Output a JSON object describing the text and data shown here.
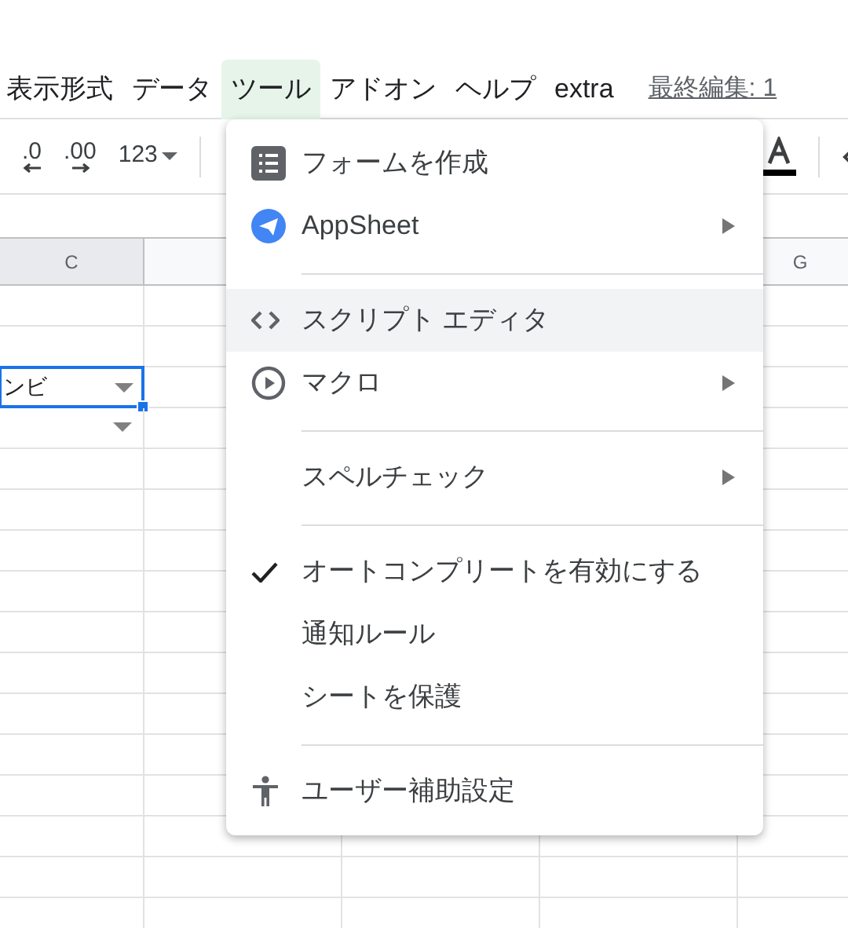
{
  "menu_bar": [
    {
      "label": "表示形式",
      "selected": false
    },
    {
      "label": "データ",
      "selected": false
    },
    {
      "label": "ツール",
      "selected": true
    },
    {
      "label": "アドオン",
      "selected": false
    },
    {
      "label": "ヘルプ",
      "selected": false
    },
    {
      "label": "extra",
      "selected": false
    }
  ],
  "last_edit": "最終編集: 1",
  "toolbar": {
    "decrease_decimals": ".0",
    "increase_decimals": ".00",
    "format": "123"
  },
  "columns": [
    {
      "label": "C"
    },
    {
      "label": "G"
    }
  ],
  "active_cell": {
    "value": "ンビ"
  },
  "menu": [
    {
      "kind": "item",
      "label": "フォームを作成",
      "submenu": false,
      "selected": false,
      "checked": false
    },
    {
      "kind": "item",
      "label": "AppSheet",
      "submenu": true,
      "selected": false,
      "checked": false
    },
    {
      "kind": "divider"
    },
    {
      "kind": "item",
      "label": "スクリプト エディタ",
      "submenu": false,
      "selected": true,
      "checked": false
    },
    {
      "kind": "item",
      "label": "マクロ",
      "submenu": true,
      "selected": false,
      "checked": false
    },
    {
      "kind": "divider"
    },
    {
      "kind": "item",
      "label": "スペルチェック",
      "submenu": true,
      "selected": false,
      "checked": false
    },
    {
      "kind": "divider"
    },
    {
      "kind": "item",
      "label": "オートコンプリートを有効にする",
      "submenu": false,
      "selected": false,
      "checked": true
    },
    {
      "kind": "item",
      "label": "通知ルール",
      "submenu": false,
      "selected": false,
      "checked": false
    },
    {
      "kind": "item",
      "label": "シートを保護",
      "submenu": false,
      "selected": false,
      "checked": false
    },
    {
      "kind": "divider"
    },
    {
      "kind": "item",
      "label": "ユーザー補助設定",
      "submenu": false,
      "selected": false,
      "checked": false
    }
  ]
}
